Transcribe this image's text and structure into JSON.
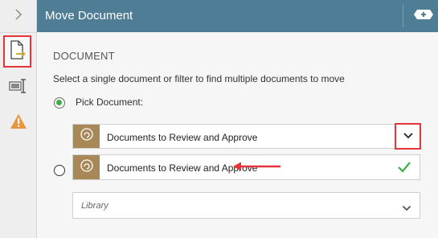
{
  "header": {
    "title": "Move Document",
    "action_icon": "add-icon"
  },
  "sidebar": {
    "items": [
      {
        "name": "expand",
        "icon": "chevron-right-icon"
      },
      {
        "name": "move-document",
        "icon": "move-document-icon"
      },
      {
        "name": "properties",
        "icon": "properties-icon"
      },
      {
        "name": "warning",
        "icon": "warning-icon"
      }
    ]
  },
  "content": {
    "section_title": "DOCUMENT",
    "instructions": "Select a single document or filter to find multiple documents to move",
    "pick_document_label": "Pick Document:",
    "selected_document": "Documents to Review and Approve",
    "search_result": "Documents to Review and Approve",
    "library_placeholder": "Library"
  },
  "colors": {
    "header_bg": "#4f7d95",
    "doc_badge_bg": "#a88857",
    "highlight_red": "#e5353b",
    "radio_green": "#3cae49",
    "check_green": "#3cae49"
  }
}
